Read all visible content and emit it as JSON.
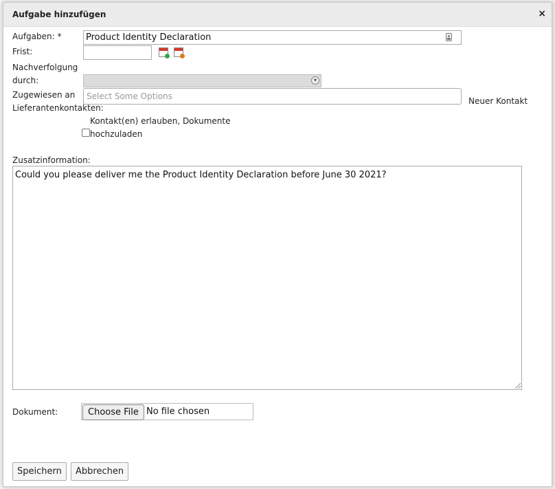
{
  "dialog": {
    "title": "Aufgabe hinzufügen",
    "close_label": "×"
  },
  "form": {
    "task_label": "Aufgaben: *",
    "task_value": "Product Identity Declaration",
    "deadline_label": "Frist:",
    "deadline_value": "",
    "followup_label_line1": "Nachverfolgung",
    "followup_label_line2": "durch:",
    "assigned_label_line1": "Zugewiesen an",
    "assigned_label_line2": "Lieferantenkontakten:",
    "assigned_placeholder": "Select Some Options",
    "new_contact_label": "Neuer Kontakt",
    "upload_label_line1": "Kontakt(en) erlauben, Dokumente",
    "upload_label_line2": "hochzuladen",
    "info_label": "Zusatzinformation:",
    "info_value": "Could you please deliver me the Product Identity Declaration before June 30 2021?",
    "document_label": "Dokument:",
    "file_button_label": "Choose File",
    "file_status": "No file chosen"
  },
  "actions": {
    "save_label": "Speichern",
    "cancel_label": "Abbrechen"
  },
  "icons": {
    "calendar_add": "calendar-add-icon",
    "calendar_remove": "calendar-remove-icon",
    "contact": "contact-card-icon"
  }
}
